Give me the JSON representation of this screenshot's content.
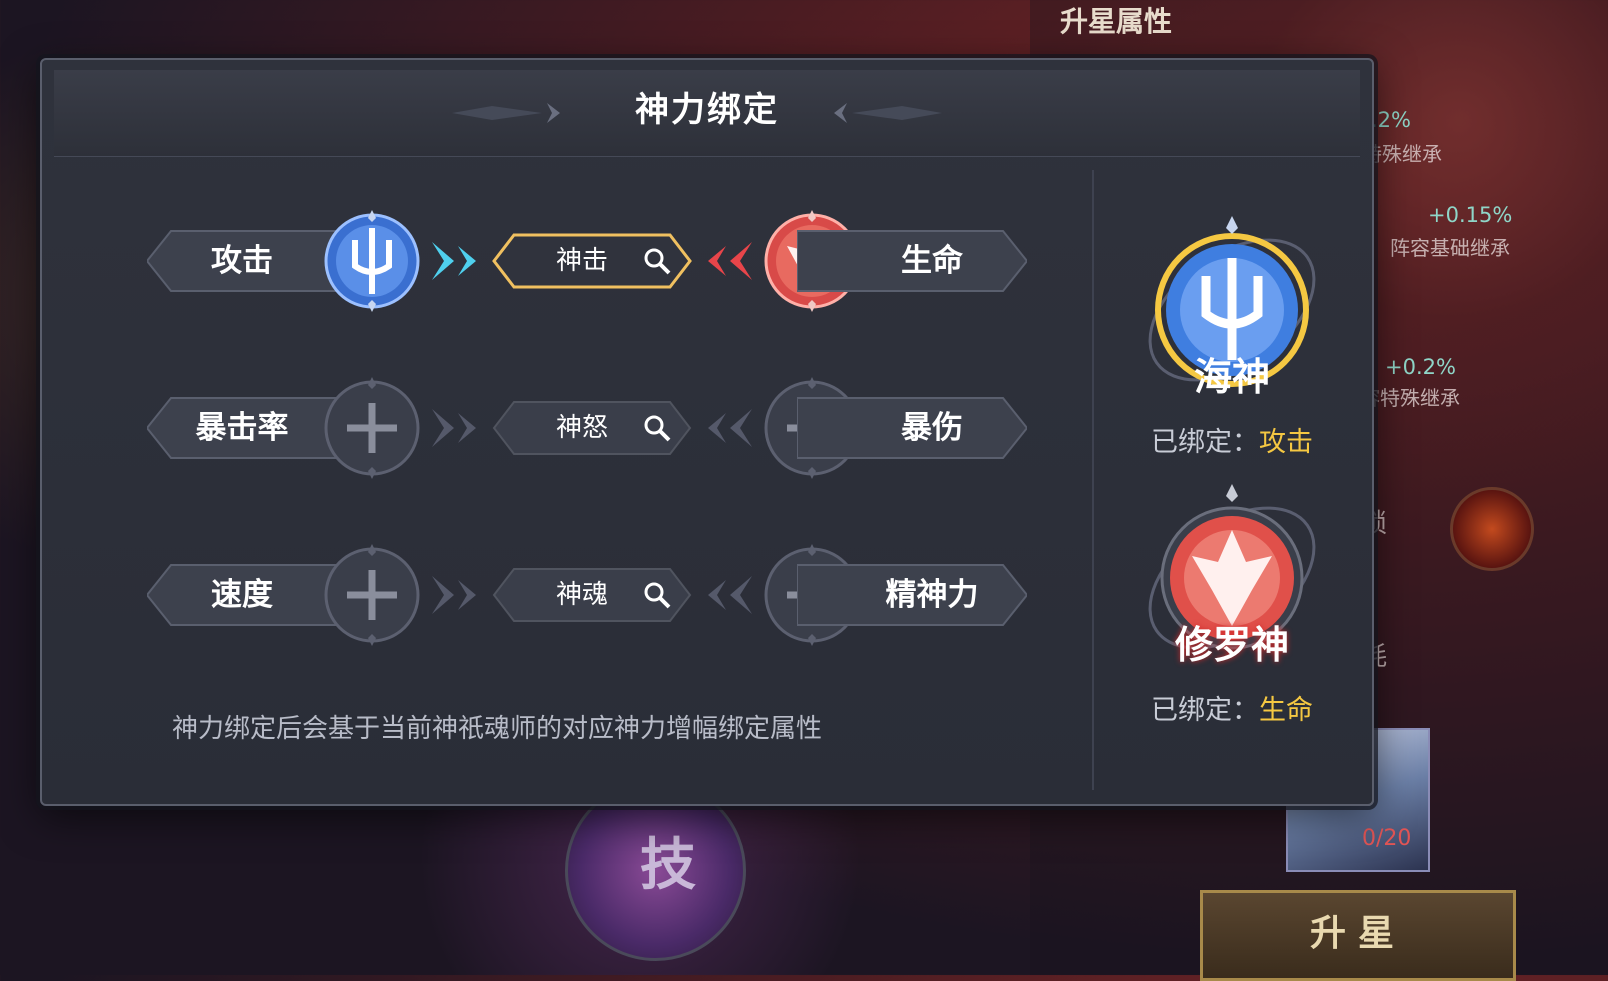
{
  "background": {
    "heading": "升星属性",
    "stats": [
      {
        "value": "+0.2%",
        "label": "阵容特殊继承"
      },
      {
        "value": "+0.15%",
        "label": "阵容基础继承"
      },
      {
        "value": "+0.2%",
        "label": "阵容特殊继承"
      }
    ],
    "unlock_label": "解锁",
    "cost_label": "消耗",
    "portrait_count": "0/20",
    "skill_badge": "技",
    "star_button": "升星"
  },
  "dialog": {
    "title": "神力绑定",
    "rows": [
      {
        "left_attr": "攻击",
        "center": "神击",
        "right_attr": "生命",
        "left_orb": "trident-blue",
        "right_orb": "asura-red",
        "active": true
      },
      {
        "left_attr": "暴击率",
        "center": "神怒",
        "right_attr": "暴伤",
        "left_orb": "empty-plus",
        "right_orb": "empty-plus",
        "active": false
      },
      {
        "left_attr": "速度",
        "center": "神魂",
        "right_attr": "精神力",
        "left_orb": "empty-plus",
        "right_orb": "empty-plus",
        "active": false
      }
    ],
    "note": "神力绑定后会基于当前神祇魂师的对应神力增幅绑定属性",
    "gods": [
      {
        "name": "海神",
        "bound_label": "已绑定：",
        "bound_value": "攻击",
        "color": "#3f7ee0"
      },
      {
        "name": "修罗神",
        "bound_label": "已绑定：",
        "bound_value": "生命",
        "color": "#e0504a"
      }
    ]
  },
  "colors": {
    "accent_gold": "#f5c842",
    "blue_arrow": "#4fd0ee",
    "red_arrow": "#e8454a"
  }
}
